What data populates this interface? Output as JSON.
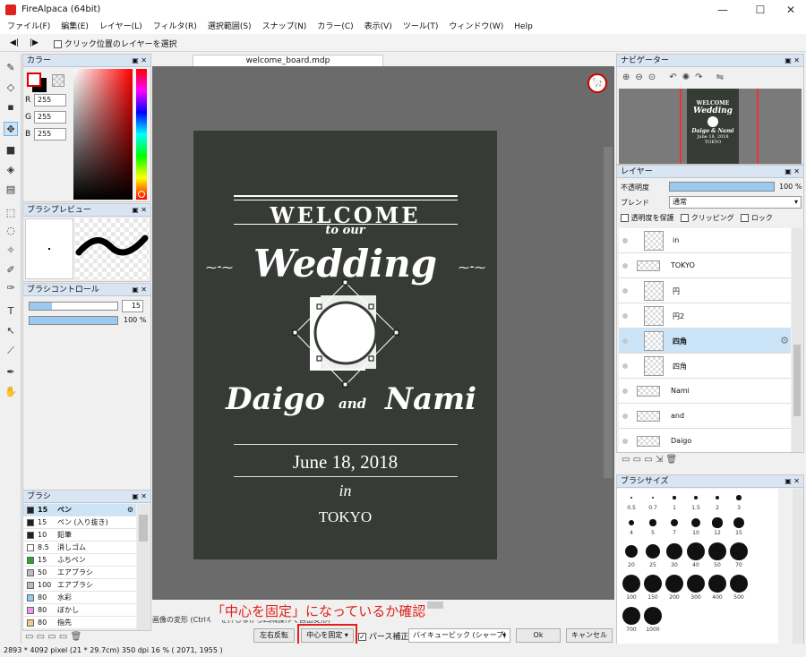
{
  "window": {
    "title": "FireAlpaca (64bit)",
    "minimize": "—",
    "maximize": "☐",
    "close": "✕"
  },
  "menu": [
    "ファイル(F)",
    "編集(E)",
    "レイヤー(L)",
    "フィルタ(R)",
    "選択範囲(S)",
    "スナップ(N)",
    "カラー(C)",
    "表示(V)",
    "ツール(T)",
    "ウィンドウ(W)",
    "Help"
  ],
  "toolbar": {
    "prev": "◀|",
    "next": "|▶",
    "checkbox_label": "クリック位置のレイヤーを選択"
  },
  "color_panel": {
    "title": "カラー",
    "r_label": "R",
    "g_label": "G",
    "b_label": "B",
    "r": "255",
    "g": "255",
    "b": "255"
  },
  "brush_preview": {
    "title": "ブラシプレビュー"
  },
  "brush_control": {
    "title": "ブラシコントロール",
    "size": "15",
    "opacity": "100 %",
    "size_fill": 0.25,
    "opacity_fill": 1.0
  },
  "brush_panel": {
    "title": "ブラシ",
    "items": [
      {
        "size": "15",
        "name": "ペン",
        "color": "#222222",
        "selected": true
      },
      {
        "size": "15",
        "name": "ペン (入り抜き)",
        "color": "#222222"
      },
      {
        "size": "10",
        "name": "鉛筆",
        "color": "#222222"
      },
      {
        "size": "8.5",
        "name": "消しゴム",
        "color": "#ffffff"
      },
      {
        "size": "15",
        "name": "ふちペン",
        "color": "#22aa22"
      },
      {
        "size": "50",
        "name": "エアブラシ",
        "color": "#bbbbbb"
      },
      {
        "size": "100",
        "name": "エアブラシ",
        "color": "#bbbbbb"
      },
      {
        "size": "80",
        "name": "水彩",
        "color": "#88ccee"
      },
      {
        "size": "80",
        "name": "ぼかし",
        "color": "#ee99ee"
      },
      {
        "size": "80",
        "name": "指先",
        "color": "#eecc88"
      }
    ]
  },
  "document": {
    "tab": "welcome_board.mdp"
  },
  "board": {
    "welcome": "WELCOME",
    "to_our": "to our",
    "wedding": "Wedding",
    "daigo": "Daigo",
    "and": "and",
    "nami": "Nami",
    "date": "June 18, 2018",
    "in": "in",
    "city": "TOKYO"
  },
  "transform_bar": {
    "hint": "画像の変形 (Ctrlキーを押しながら四隅操作で自由変形)",
    "annotation": "「中心を固定」になっているか確認",
    "flip": "左右反転",
    "fix_center": "中心を固定",
    "perspective": "パース補正",
    "interp": "バイキュービック (シャープ)",
    "ok": "Ok",
    "cancel": "キャンセル"
  },
  "navigator": {
    "title": "ナビゲーター",
    "thumb_welcome": "WELCOME",
    "thumb_wedding": "Wedding",
    "thumb_names": "Daigo & Nami",
    "thumb_date": "June 18, 2018",
    "thumb_city": "TOKYO"
  },
  "layers": {
    "title": "レイヤー",
    "opacity_label": "不透明度",
    "opacity_value": "100 %",
    "opacity_fill": 1.0,
    "blend_label": "ブレンド",
    "blend_value": "通常",
    "protect": "透明度を保護",
    "clipping": "クリッピング",
    "lock": "ロック",
    "items": [
      {
        "name": "in",
        "indent": 1
      },
      {
        "name": "TOKYO",
        "indent": 0
      },
      {
        "name": "円",
        "indent": 1
      },
      {
        "name": "円2",
        "indent": 1
      },
      {
        "name": "四角",
        "indent": 1,
        "selected": true
      },
      {
        "name": "四角",
        "indent": 1
      },
      {
        "name": "Nami",
        "indent": 0
      },
      {
        "name": "and",
        "indent": 0
      },
      {
        "name": "Daigo",
        "indent": 0
      }
    ]
  },
  "brush_size": {
    "title": "ブラシサイズ",
    "sizes": [
      "0.5",
      "0.7",
      "1",
      "1.5",
      "2",
      "3",
      "4",
      "5",
      "7",
      "10",
      "12",
      "15",
      "20",
      "25",
      "30",
      "40",
      "50",
      "70",
      "100",
      "150",
      "200",
      "300",
      "400",
      "500",
      "700",
      "1000"
    ]
  },
  "status": {
    "dimensions": "2893 * 4092 pixel",
    "cm": "(21 * 29.7cm)",
    "dpi": "350 dpi",
    "zoom": "16 %",
    "coords": "( 2071, 1955 )"
  },
  "colors": {
    "accent": "#cce4f7",
    "annotation": "#e0201a",
    "board": "#373b36"
  }
}
